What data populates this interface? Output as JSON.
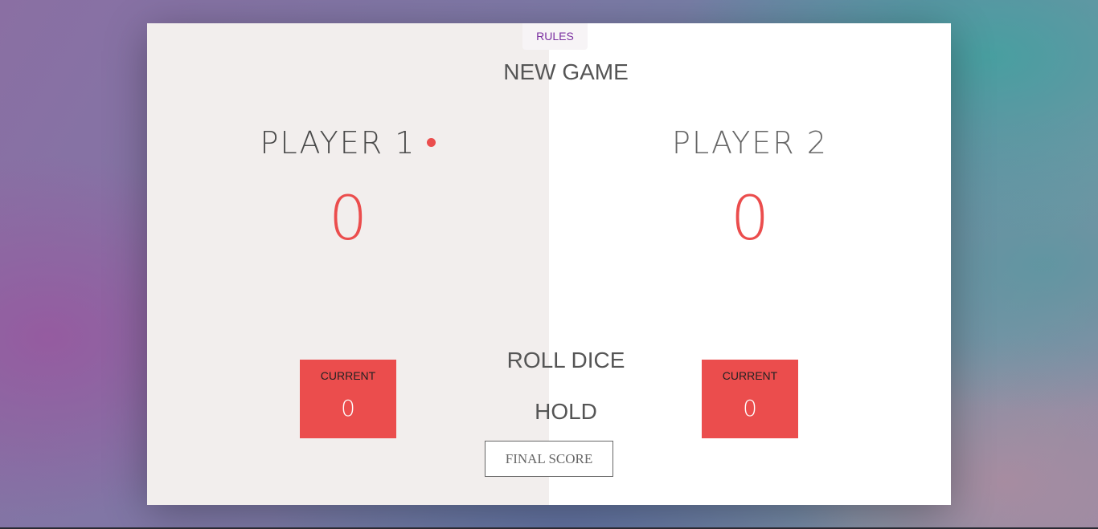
{
  "buttons": {
    "rules": "RULES",
    "new_game": "NEW GAME",
    "roll_dice": "ROLL DICE",
    "hold": "HOLD"
  },
  "final_score": {
    "placeholder": "FINAL SCORE",
    "value": ""
  },
  "players": [
    {
      "name": "PLAYER 1",
      "score": "0",
      "current_label": "CURRENT",
      "current_score": "0",
      "active": true
    },
    {
      "name": "PLAYER 2",
      "score": "0",
      "current_label": "CURRENT",
      "current_score": "0",
      "active": false
    }
  ],
  "colors": {
    "accent": "#eb4d4d",
    "active_panel": "#f2eeed",
    "rules_text": "#7a2fa0"
  }
}
